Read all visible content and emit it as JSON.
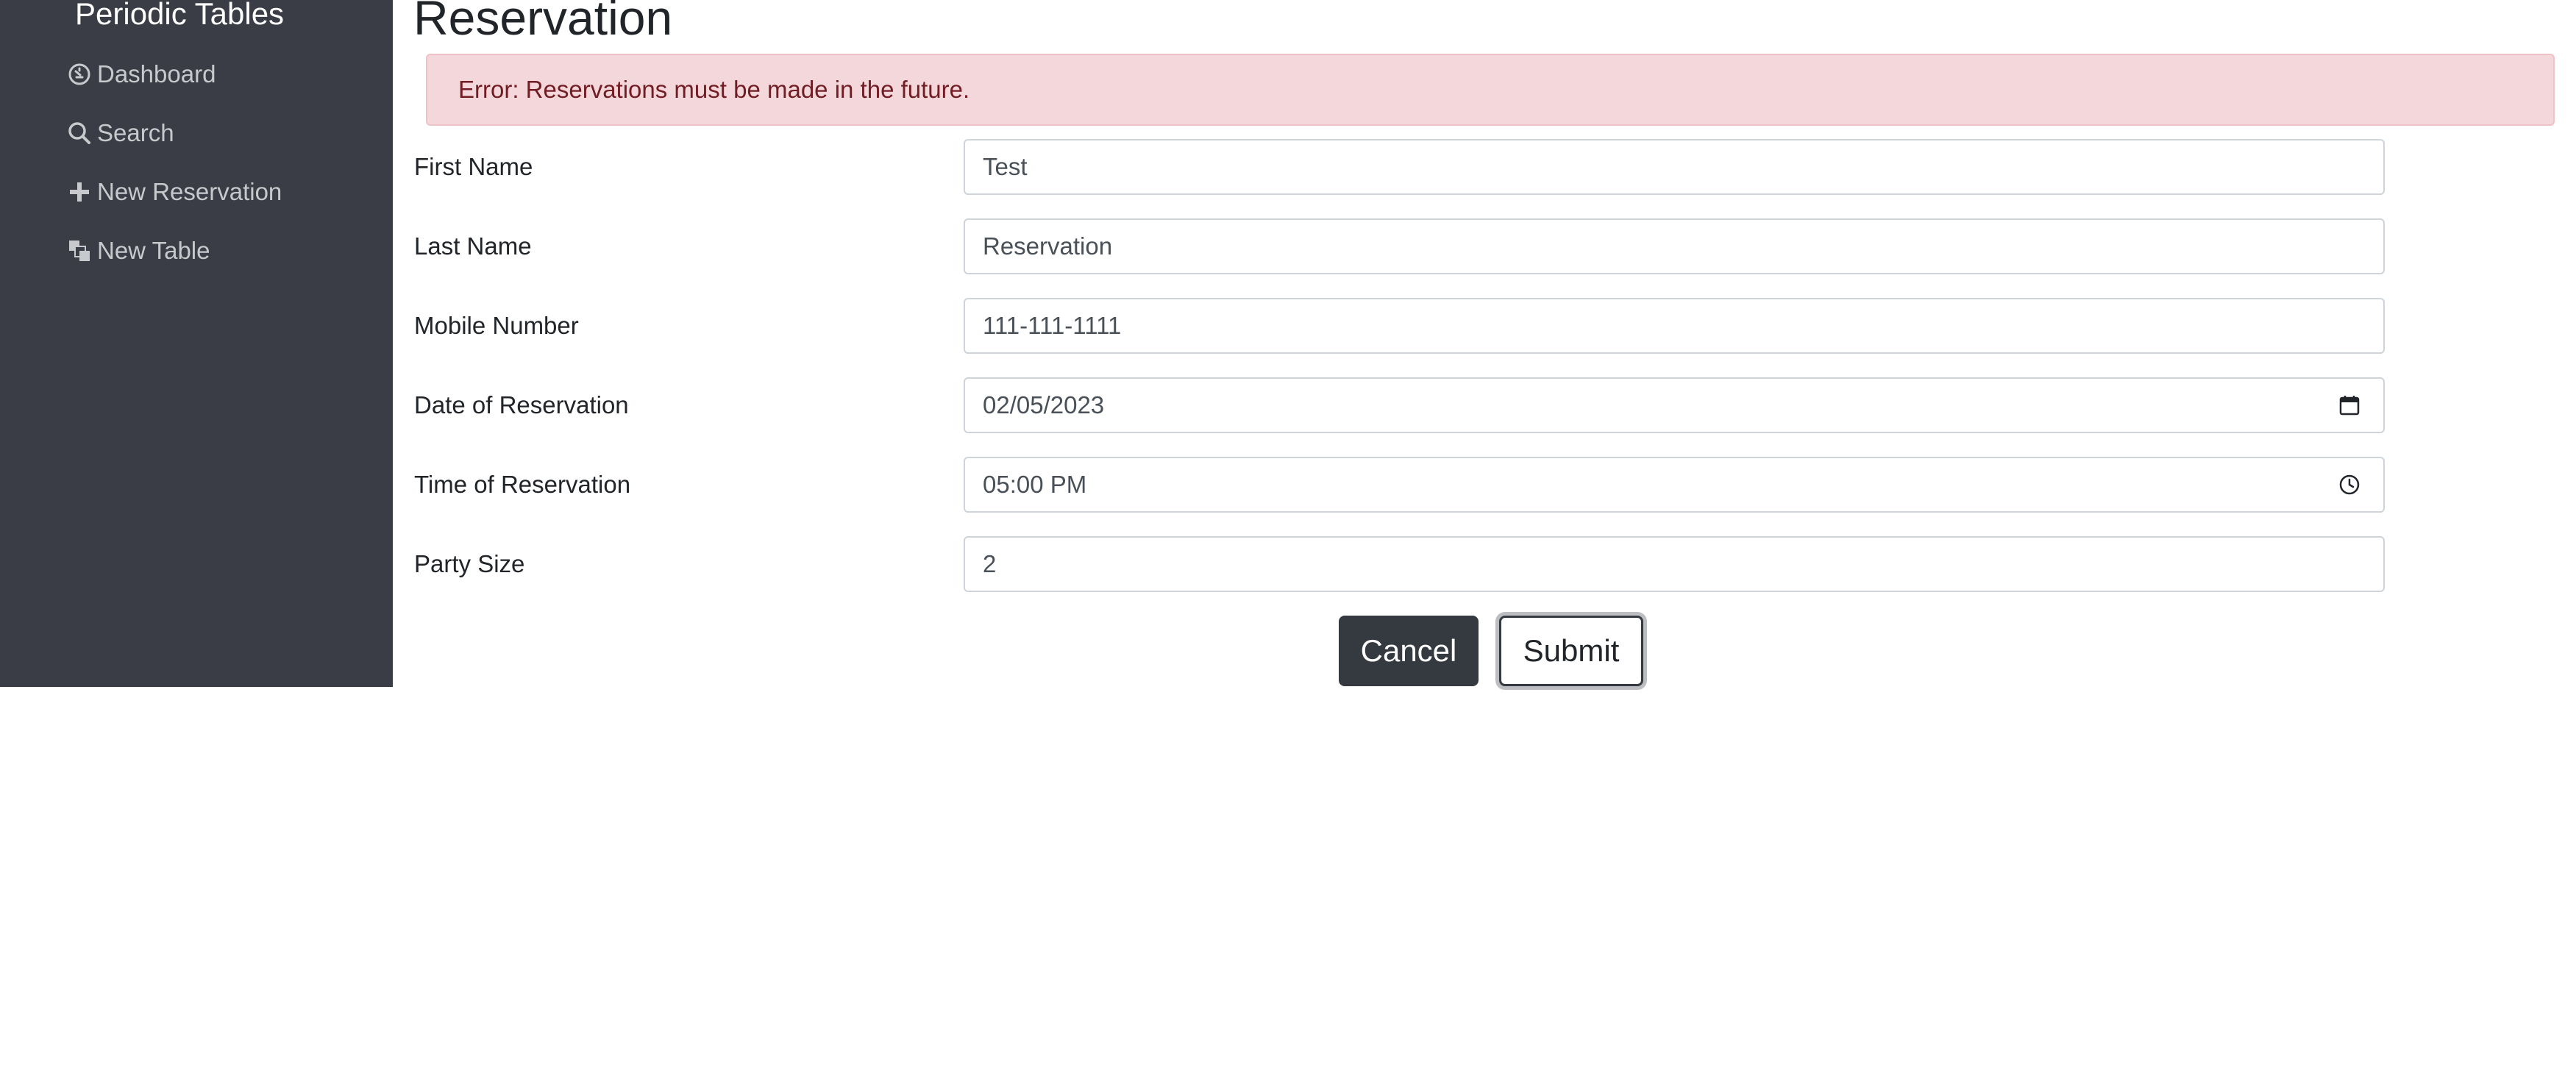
{
  "sidebar": {
    "brand": "Periodic Tables",
    "items": [
      {
        "label": "Dashboard",
        "icon": "dashboard-icon"
      },
      {
        "label": "Search",
        "icon": "search-icon"
      },
      {
        "label": "New Reservation",
        "icon": "plus-icon"
      },
      {
        "label": "New Table",
        "icon": "layers-icon"
      }
    ]
  },
  "main": {
    "title": "Reservation",
    "error": "Error: Reservations must be made in the future.",
    "fields": [
      {
        "label": "First Name",
        "value": "Test"
      },
      {
        "label": "Last Name",
        "value": "Reservation"
      },
      {
        "label": "Mobile Number",
        "value": "111-111-1111"
      },
      {
        "label": "Date of Reservation",
        "value": "02/05/2023",
        "icon": "calendar-icon"
      },
      {
        "label": "Time of Reservation",
        "value": "05:00 PM",
        "icon": "clock-icon"
      },
      {
        "label": "Party Size",
        "value": "2"
      }
    ],
    "buttons": {
      "cancel": "Cancel",
      "submit": "Submit"
    }
  },
  "colors": {
    "sidebar_bg": "#3b3d46",
    "alert_bg": "#f3d7da",
    "alert_text": "#721c24",
    "cancel_bg": "#343a40"
  }
}
